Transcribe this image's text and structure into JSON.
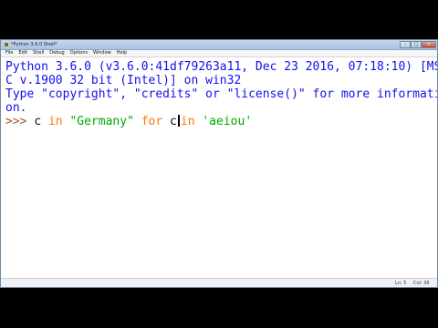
{
  "window": {
    "title": "*Python 3.6.0 Shell*",
    "buttons": {
      "minimize": "–",
      "maximize": "□",
      "close": "✕"
    }
  },
  "menu": {
    "items": [
      "File",
      "Edit",
      "Shell",
      "Debug",
      "Options",
      "Window",
      "Help"
    ]
  },
  "shell": {
    "banner_line1": "Python 3.6.0 (v3.6.0:41df79263a11, Dec 23 2016, 07:18:10) [MS",
    "banner_line2": "C v.1900 32 bit (Intel)] on win32",
    "banner_line3": "Type \"copyright\", \"credits\" or \"license()\" for more informati",
    "banner_line4": "on.",
    "prompt": ">>> ",
    "input": {
      "part1": "c ",
      "kw_in1": "in",
      "part2": " ",
      "str1": "\"Germany\"",
      "part3": " ",
      "kw_for": "for",
      "part4": " c",
      "kw_in2": "in",
      "part5": " ",
      "str2": "'aeiou'"
    }
  },
  "status": {
    "line": "Ln: 5",
    "col": "Col: 36"
  },
  "colors": {
    "output": "#1111ee",
    "prompt": "#a0522d",
    "keyword": "#ff7700",
    "string": "#00aa00"
  }
}
